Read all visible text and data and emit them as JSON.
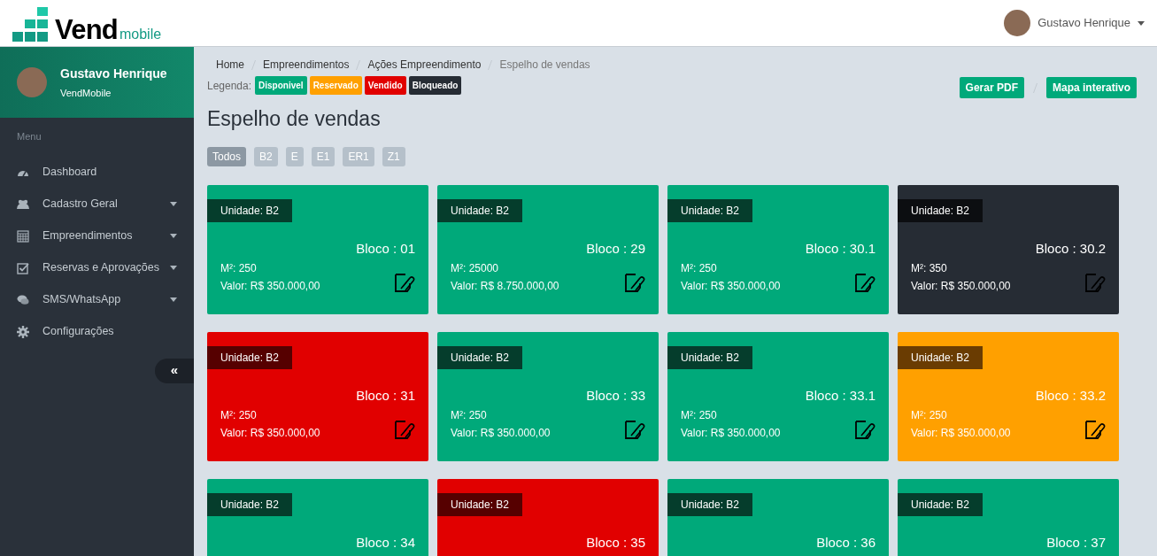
{
  "header": {
    "logo_main": "Vend",
    "logo_sub": "mobile",
    "user_name": "Gustavo Henrique"
  },
  "sidebar": {
    "profile_name": "Gustavo Henrique",
    "profile_org": "VendMobile",
    "section_label": "Menu",
    "items": [
      {
        "label": "Dashboard",
        "kind": "dashboard",
        "has_submenu": false
      },
      {
        "label": "Cadastro Geral",
        "kind": "users",
        "has_submenu": true
      },
      {
        "label": "Empreendimentos",
        "kind": "table",
        "has_submenu": true
      },
      {
        "label": "Reservas e Aprovações",
        "kind": "check",
        "has_submenu": true
      },
      {
        "label": "SMS/WhatsApp",
        "kind": "chat",
        "has_submenu": true
      },
      {
        "label": "Configurações",
        "kind": "gear",
        "has_submenu": false
      }
    ],
    "collapse_label": "«"
  },
  "breadcrumb": [
    "Home",
    "Empreendimentos",
    "Ações Empreendimento",
    "Espelho de vendas"
  ],
  "legend": {
    "label": "Legenda:",
    "items": [
      {
        "label": "Disponivel",
        "kind": "available"
      },
      {
        "label": "Reservado",
        "kind": "reserved"
      },
      {
        "label": "Vendido",
        "kind": "sold"
      },
      {
        "label": "Bloqueado",
        "kind": "blocked"
      }
    ]
  },
  "actions": [
    "Gerar PDF",
    "Mapa interativo"
  ],
  "title": "Espelho de vendas",
  "filters": [
    {
      "label": "Todos",
      "selected": true
    },
    {
      "label": "B2",
      "selected": false
    },
    {
      "label": "E",
      "selected": false
    },
    {
      "label": "E1",
      "selected": false
    },
    {
      "label": "ER1",
      "selected": false
    },
    {
      "label": "Z1",
      "selected": false
    }
  ],
  "units": [
    {
      "unit": "Unidade: B2",
      "bloco": "Bloco : 01",
      "m2": "M²: 250",
      "valor": "Valor: R$ 350.000,00",
      "kind": "available"
    },
    {
      "unit": "Unidade: B2",
      "bloco": "Bloco : 29",
      "m2": "M²: 25000",
      "valor": "Valor: R$ 8.750.000,00",
      "kind": "available"
    },
    {
      "unit": "Unidade: B2",
      "bloco": "Bloco : 30.1",
      "m2": "M²: 250",
      "valor": "Valor: R$ 350.000,00",
      "kind": "available"
    },
    {
      "unit": "Unidade: B2",
      "bloco": "Bloco : 30.2",
      "m2": "M²: 350",
      "valor": "Valor: R$ 350.000,00",
      "kind": "blocked"
    },
    {
      "unit": "Unidade: B2",
      "bloco": "Bloco : 31",
      "m2": "M²: 250",
      "valor": "Valor: R$ 350.000,00",
      "kind": "sold"
    },
    {
      "unit": "Unidade: B2",
      "bloco": "Bloco : 33",
      "m2": "M²: 250",
      "valor": "Valor: R$ 350.000,00",
      "kind": "available"
    },
    {
      "unit": "Unidade: B2",
      "bloco": "Bloco : 33.1",
      "m2": "M²: 250",
      "valor": "Valor: R$ 350.000,00",
      "kind": "available"
    },
    {
      "unit": "Unidade: B2",
      "bloco": "Bloco : 33.2",
      "m2": "M²: 250",
      "valor": "Valor: R$ 350.000,00",
      "kind": "reserved"
    },
    {
      "unit": "Unidade: B2",
      "bloco": "Bloco : 34",
      "kind": "available"
    },
    {
      "unit": "Unidade: B2",
      "bloco": "Bloco : 35",
      "kind": "sold"
    },
    {
      "unit": "Unidade: B2",
      "bloco": "Bloco : 36",
      "kind": "available"
    },
    {
      "unit": "Unidade: B2",
      "bloco": "Bloco : 37",
      "kind": "available"
    }
  ]
}
